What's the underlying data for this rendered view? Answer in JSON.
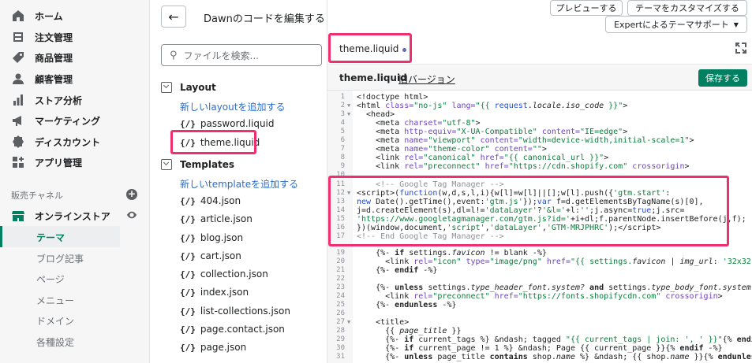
{
  "sidebar": {
    "items": [
      {
        "label": "ホーム",
        "icon": "home-icon"
      },
      {
        "label": "注文管理",
        "icon": "orders-icon"
      },
      {
        "label": "商品管理",
        "icon": "products-icon"
      },
      {
        "label": "顧客管理",
        "icon": "customers-icon"
      },
      {
        "label": "ストア分析",
        "icon": "analytics-icon"
      },
      {
        "label": "マーケティング",
        "icon": "marketing-icon"
      },
      {
        "label": "ディスカウント",
        "icon": "discounts-icon"
      },
      {
        "label": "アプリ管理",
        "icon": "apps-icon"
      }
    ],
    "sales_channels_label": "販売チャネル",
    "online_store_label": "オンラインストア",
    "sub_items": [
      "テーマ",
      "ブログ記事",
      "ページ",
      "メニュー",
      "ドメイン",
      "各種設定"
    ]
  },
  "filepanel": {
    "title": "Dawnのコードを編集する",
    "search_placeholder": "ファイルを検索...",
    "layout_label": "Layout",
    "add_layout": "新しいlayoutを追加する",
    "layout_files": [
      "password.liquid",
      "theme.liquid"
    ],
    "templates_label": "Templates",
    "add_template": "新しいtemplateを追加する",
    "template_files": [
      "404.json",
      "article.json",
      "blog.json",
      "cart.json",
      "collection.json",
      "index.json",
      "list-collections.json",
      "page.contact.json",
      "page.json"
    ],
    "file_icon": "{/}"
  },
  "header": {
    "preview": "プレビューする",
    "customize": "テーマをカスタマイズする",
    "expert": "Expertによるテーマサポート"
  },
  "editor": {
    "tab_label": "theme.liquid",
    "file_name": "theme.liquid",
    "old_version": "旧バージョン",
    "save": "保存する"
  },
  "code": {
    "line_numbers": [
      "1",
      "2",
      "3",
      "4",
      "5",
      "6",
      "7",
      "8",
      "9",
      "10",
      "11",
      "12",
      "13",
      "14",
      "15",
      "16",
      "17",
      "19",
      "20",
      "21",
      "22",
      "23",
      "24",
      "25",
      "26",
      "27",
      "28",
      "29",
      "30",
      "31"
    ]
  },
  "colors": {
    "accent": "#008060",
    "highlight": "#ef2f6e",
    "link": "#2c6ecb"
  }
}
